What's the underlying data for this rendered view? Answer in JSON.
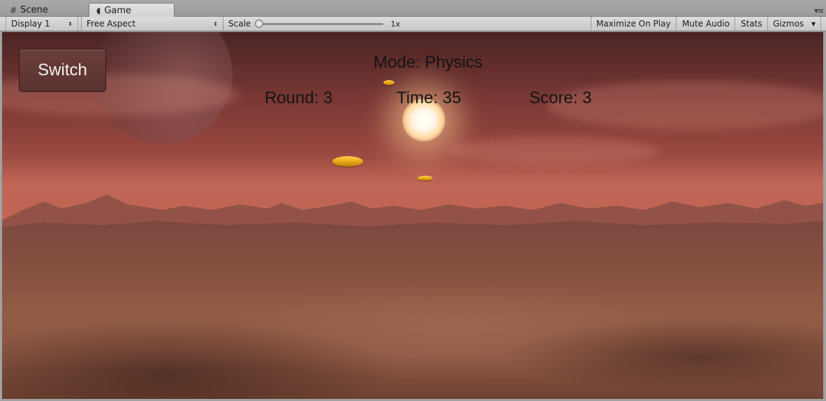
{
  "tabs": [
    {
      "label": "Scene",
      "icon": "grid-icon"
    },
    {
      "label": "Game",
      "icon": "pacman-icon"
    }
  ],
  "toolbar": {
    "display": "Display 1",
    "aspect": "Free Aspect",
    "scale_label": "Scale",
    "scale_value": "1x",
    "scale_level": 0.0,
    "maximize_on_play": "Maximize On Play",
    "mute_audio": "Mute Audio",
    "stats": "Stats",
    "gizmos": "Gizmos"
  },
  "game": {
    "switch_label": "Switch",
    "mode": "Mode: Physics",
    "round": "Round: 3",
    "time": "Time: 35",
    "score": "Score: 3"
  },
  "colors": {
    "sky": "#b65d4f",
    "ground": "#8c5743",
    "coin": "#e6a515",
    "button": "#5a3230"
  }
}
